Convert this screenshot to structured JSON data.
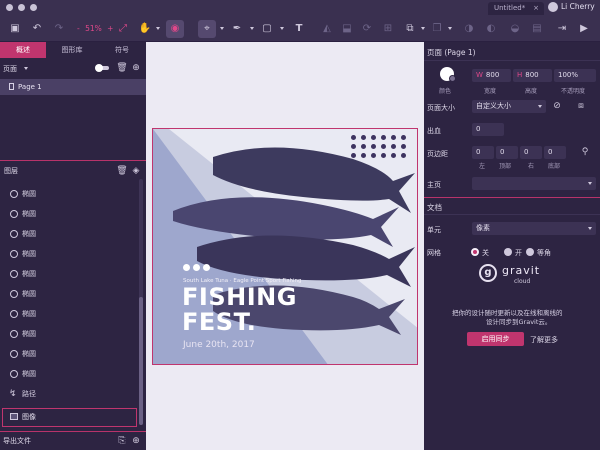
{
  "window": {
    "doc_tab": "Untitled*",
    "doc_tab_close": "×",
    "user_name": "Li Cherry"
  },
  "toolbar": {
    "zoom_minus": "-",
    "zoom_value": "51%",
    "zoom_plus": "+",
    "text_tool": "T"
  },
  "left_panel": {
    "tabs": [
      "概述",
      "图形库",
      "符号"
    ],
    "pages_label": "页面",
    "pages": [
      {
        "label": "Page 1"
      }
    ],
    "layers_label": "图层",
    "layers": [
      {
        "label": "椭圆",
        "kind": "ellipse"
      },
      {
        "label": "椭圆",
        "kind": "ellipse"
      },
      {
        "label": "椭圆",
        "kind": "ellipse"
      },
      {
        "label": "椭圆",
        "kind": "ellipse"
      },
      {
        "label": "椭圆",
        "kind": "ellipse"
      },
      {
        "label": "椭圆",
        "kind": "ellipse"
      },
      {
        "label": "椭圆",
        "kind": "ellipse"
      },
      {
        "label": "椭圆",
        "kind": "ellipse"
      },
      {
        "label": "椭圆",
        "kind": "ellipse"
      },
      {
        "label": "椭圆",
        "kind": "ellipse"
      },
      {
        "label": "路径",
        "kind": "path"
      }
    ],
    "image_layer": "图像",
    "export_label": "导出文件"
  },
  "poster": {
    "subtitle": "South Lake Tuna · Eagle Point Sport Fishing",
    "title_line1": "FISHING",
    "title_line2": "FEST.",
    "date": "June 20th, 2017"
  },
  "right_panel": {
    "page_title": "页面 (Page 1)",
    "color_label": "颜色",
    "width_prefix": "W",
    "width_value": "800",
    "width_label": "宽度",
    "height_prefix": "H",
    "height_value": "800",
    "height_label": "高度",
    "opacity_value": "100%",
    "opacity_label": "不透明度",
    "page_size_label": "页面大小",
    "page_size_value": "自定义大小",
    "bleed_label": "出血",
    "bleed_value": "0",
    "margin_label": "页边距",
    "margin_values": [
      "0",
      "0",
      "0",
      "0"
    ],
    "margin_sides": [
      "左",
      "顶部",
      "右",
      "底部"
    ],
    "master_label": "主页",
    "document_label": "文档",
    "unit_label": "单元",
    "unit_value": "像素",
    "grid_label": "网格",
    "grid_options": [
      "关",
      "开",
      "等角"
    ],
    "gravit_name": "gravit",
    "gravit_sub": "cloud",
    "cloud_msg_line1": "把你的设计随时更新以及在线和离线的",
    "cloud_msg_line2": "设计同步到Gravit云。",
    "sync_button": "启用同步",
    "learn_more": "了解更多"
  }
}
